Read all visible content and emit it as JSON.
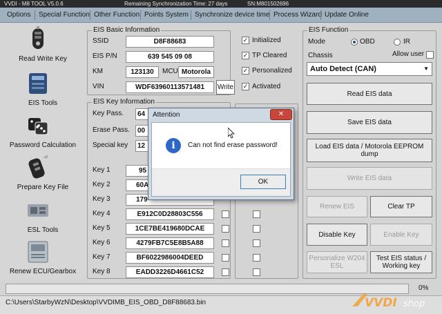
{
  "titlebar": {
    "title": "VVDI - M8 TOOL V5.0.6",
    "sync": "Remaining Synchronization Time: 27 days",
    "sn": "SN:M801502696"
  },
  "menu": {
    "items": [
      "Options",
      "Special Function",
      "Other Function",
      "Points System",
      "Synchronize device time",
      "Process Wizard",
      "Update Online"
    ]
  },
  "sidebar": {
    "items": [
      {
        "label": "Read Write Key",
        "icon": "car-key-icon"
      },
      {
        "label": "EIS Tools",
        "icon": "eis-module-icon"
      },
      {
        "label": "Password Calculation",
        "icon": "dice-icon"
      },
      {
        "label": "Prepare Key File",
        "icon": "keyfob-icon"
      },
      {
        "label": "ESL Tools",
        "icon": "esl-module-icon"
      },
      {
        "label": "Renew ECU/Gearbox",
        "icon": "ecu-module-icon"
      }
    ]
  },
  "eis_basic": {
    "title": "EIS Basic Information",
    "ssid_label": "SSID",
    "ssid": "D8F88683",
    "pn_label": "EIS P/N",
    "pn": "639 545 09 08",
    "km_label": "KM",
    "km": "123130",
    "mcu_label": "MCU",
    "mcu": "Motorola",
    "vin_label": "VIN",
    "vin": "WDF63960113571481",
    "write_label": "Write",
    "flags": [
      {
        "label": "Initialized",
        "checked": true
      },
      {
        "label": "TP Cleared",
        "checked": true
      },
      {
        "label": "Personalized",
        "checked": true
      },
      {
        "label": "Activated",
        "checked": true
      }
    ]
  },
  "eis_key": {
    "title": "EIS Key Information",
    "keypass_label": "Key Pass.",
    "keypass": "64",
    "erasepass_label": "Erase Pass.",
    "erasepass": "00",
    "special_label": "Special key",
    "special": "12",
    "keys": [
      {
        "label": "Key 1",
        "value": "95"
      },
      {
        "label": "Key 2",
        "value": "60A"
      },
      {
        "label": "Key 3",
        "value": "179"
      },
      {
        "label": "Key 4",
        "value": "E912C0D28803C556"
      },
      {
        "label": "Key 5",
        "value": "1CE7BE419680DCAE"
      },
      {
        "label": "Key 6",
        "value": "4279FB7C5E8B5A88"
      },
      {
        "label": "Key 7",
        "value": "BF6022986004DEED"
      },
      {
        "label": "Key 8",
        "value": "EADD3226D4661C52"
      }
    ]
  },
  "eis_function": {
    "title": "EIS Function",
    "mode_label": "Mode",
    "mode_options": [
      "OBD",
      "IR"
    ],
    "mode_selected": "OBD",
    "chassis_label": "Chassis",
    "allow_user_label": "Allow user",
    "chassis_value": "Auto Detect (CAN)",
    "buttons": {
      "read_eis": "Read EIS data",
      "save_eis": "Save EIS data",
      "load_eis": "Load EIS data / Motorola EEPROM dump",
      "write_eis": "Write EIS data",
      "renew_eis": "Renew EIS",
      "clear_tp": "Clear TP",
      "disable_key": "Disable Key",
      "enable_key": "Enable Key",
      "personalize": "Personalize W204 ESL",
      "test_eis": "Test EIS status / Working key"
    }
  },
  "progress": {
    "percent_label": "0%",
    "value": 0
  },
  "status": {
    "path": "C:\\Users\\StarbyWzN\\Desktop\\VVDIMB_EIS_OBD_D8F88683.bin"
  },
  "dialog": {
    "title": "Attention",
    "close": "✕",
    "message": "Can not find erase password!",
    "ok": "OK"
  },
  "watermark": {
    "text_v": "VVDI",
    "text_s": "shop"
  },
  "colors": {
    "menubar": "#9fb0bf",
    "titlebar": "#2b2b2b",
    "dialog_icon": "#2f67c8",
    "close_red": "#c8463a",
    "watermark": "#f0a23a"
  }
}
